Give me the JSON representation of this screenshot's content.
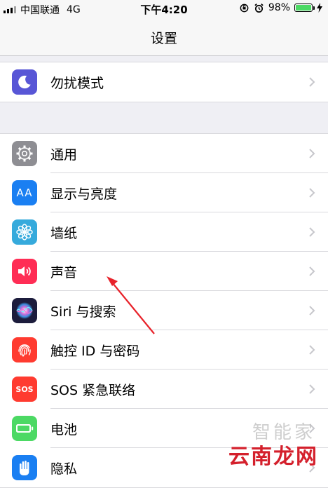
{
  "status_bar": {
    "carrier": "中国联通",
    "network": "4G",
    "time": "下午4:20",
    "battery": "98%",
    "battery_level": 0.98,
    "battery_color": "#4cd964"
  },
  "nav": {
    "title": "设置"
  },
  "groups": [
    {
      "rows": [
        {
          "label": "勿扰模式",
          "icon": "moon-icon",
          "color": "#5856d6"
        }
      ]
    },
    {
      "rows": [
        {
          "label": "通用",
          "icon": "gear-icon",
          "color": "#8e8e93"
        },
        {
          "label": "显示与亮度",
          "icon": "text-size-icon",
          "icon_text": "AA",
          "color": "#1a7ff2"
        },
        {
          "label": "墙纸",
          "icon": "flower-icon",
          "color": "#36aadc"
        },
        {
          "label": "声音",
          "icon": "speaker-icon",
          "color": "#ff2d55"
        },
        {
          "label": "Siri 与搜索",
          "icon": "siri-icon",
          "color": "#1c1c3c"
        },
        {
          "label": "触控 ID 与密码",
          "icon": "fingerprint-icon",
          "color": "#ff3b30"
        },
        {
          "label": "SOS 紧急联络",
          "icon": "sos-icon",
          "icon_text": "SOS",
          "color": "#ff3b30"
        },
        {
          "label": "电池",
          "icon": "battery-icon",
          "color": "#4cd964"
        },
        {
          "label": "隐私",
          "icon": "hand-icon",
          "color": "#1a7ff2"
        }
      ]
    }
  ],
  "watermark": {
    "line1": "智能家",
    "line2": "云南龙网"
  },
  "annotation_color": "#e8222a"
}
